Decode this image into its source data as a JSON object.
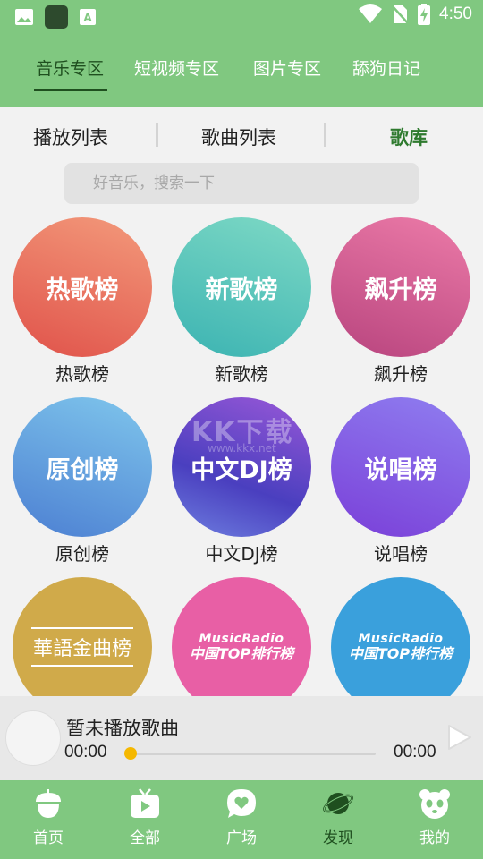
{
  "status_bar": {
    "time": "4:50",
    "left_icons": [
      "image-icon",
      "app-icon",
      "font-icon"
    ],
    "right_icons": [
      "wifi-icon",
      "no-sim-icon",
      "battery-charging-icon"
    ]
  },
  "top_tabs": [
    {
      "label": "音乐专区",
      "active": true
    },
    {
      "label": "短视频专区",
      "active": false
    },
    {
      "label": "图片专区",
      "active": false
    },
    {
      "label": "舔狗日记",
      "active": false
    }
  ],
  "sub_tabs": [
    {
      "label": "播放列表",
      "active": false
    },
    {
      "label": "歌曲列表",
      "active": false
    },
    {
      "label": "歌库",
      "active": true
    }
  ],
  "search": {
    "placeholder": "好音乐，搜索一下"
  },
  "charts": [
    {
      "circle_text": "热歌榜",
      "caption": "热歌榜"
    },
    {
      "circle_text": "新歌榜",
      "caption": "新歌榜"
    },
    {
      "circle_text": "飙升榜",
      "caption": "飙升榜"
    },
    {
      "circle_text": "原创榜",
      "caption": "原创榜"
    },
    {
      "circle_text": "中文DJ榜",
      "caption": "中文DJ榜"
    },
    {
      "circle_text": "说唱榜",
      "caption": "说唱榜"
    },
    {
      "circle_text": "華語金曲榜",
      "caption": ""
    },
    {
      "circle_text_top": "MusicRadio",
      "circle_text_bottom": "中国TOP排行榜",
      "caption": ""
    },
    {
      "circle_text_top": "MusicRadio",
      "circle_text_bottom": "中国TOP排行榜",
      "caption": ""
    }
  ],
  "watermark": {
    "text": "KK下载",
    "sub": "www.kkx.net"
  },
  "player": {
    "title": "暂未播放歌曲",
    "time_current": "00:00",
    "time_total": "00:00",
    "progress": 0
  },
  "bottom_nav": [
    {
      "label": "首页",
      "icon": "acorn-icon",
      "active": false
    },
    {
      "label": "全部",
      "icon": "tv-icon",
      "active": false
    },
    {
      "label": "广场",
      "icon": "chat-heart-icon",
      "active": false
    },
    {
      "label": "发现",
      "icon": "planet-icon",
      "active": true
    },
    {
      "label": "我的",
      "icon": "panda-icon",
      "active": false
    }
  ],
  "colors": {
    "primary_green": "#80c880",
    "active_dark_green": "#1f4f1f",
    "progress_knob": "#f5b800"
  }
}
